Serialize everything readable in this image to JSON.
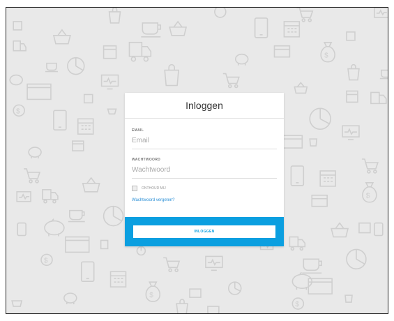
{
  "login": {
    "title": "Inloggen",
    "email_label": "EMAIL",
    "email_placeholder": "Email",
    "password_label": "WACHTWOORD",
    "password_placeholder": "Wachtwoord",
    "remember_label": "ONTHOUD MIJ",
    "forgot_link": "Wachtwoord vergeten?",
    "submit_label": "INLOGGEN"
  },
  "colors": {
    "background": "#e9e9e9",
    "accent": "#0b9fe0",
    "link": "#2a8fd6",
    "icon_stroke": "#cfcfcf"
  },
  "background_icons": [
    "cart-icon",
    "coffee-cup-icon",
    "money-bag-icon",
    "tablet-icon",
    "calendar-icon",
    "monitor-chart-icon",
    "truck-icon",
    "piggy-bank-icon",
    "pie-chart-icon",
    "shopping-bag-icon",
    "window-icon",
    "basket-icon"
  ]
}
